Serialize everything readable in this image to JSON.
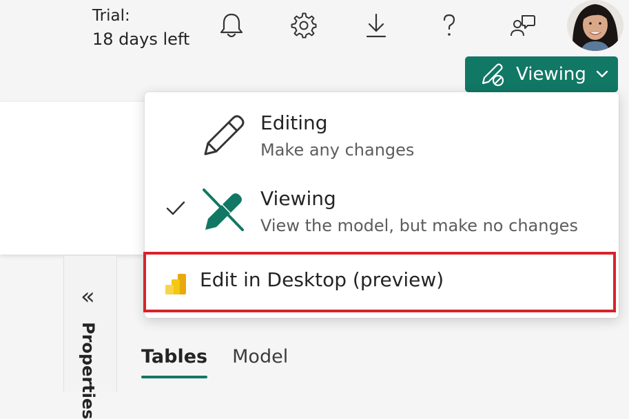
{
  "header": {
    "trial_label": "Trial:",
    "trial_days": "18 days left",
    "icons": [
      "bell-icon",
      "gear-icon",
      "download-icon",
      "help-icon",
      "feedback-icon"
    ],
    "mode_button_label": "Viewing"
  },
  "menu": {
    "editing_title": "Editing",
    "editing_desc": "Make any changes",
    "viewing_title": "Viewing",
    "viewing_desc": "View the model, but make no changes",
    "desktop_title": "Edit in Desktop (preview)",
    "selected": "Viewing"
  },
  "side_panel": {
    "collapse_glyph": "«",
    "label": "Properties"
  },
  "tabs": [
    "Tables",
    "Model"
  ],
  "colors": {
    "accent": "#117865",
    "highlight_border": "#d9222a",
    "powerbi_yellow": "#f2c811"
  }
}
